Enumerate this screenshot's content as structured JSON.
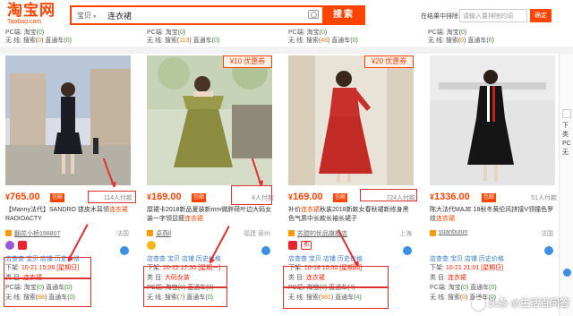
{
  "header": {
    "logo_cn": "淘宝网",
    "logo_en": "Taobao.com",
    "scope": "宝贝",
    "query": "连衣裙",
    "search_button": "搜索",
    "within_label": "在结果中排除",
    "within_placeholder": "请输入要排除的词",
    "within_button": "确定"
  },
  "previous_rows": [
    {
      "pc": "PC端: 淘宝(",
      "pc_n": "0",
      "pc_s": ")",
      "nl": "无 线: 搜索(",
      "n1": "0",
      "mid": ") 直通车(",
      "n2": "0",
      "end": ")"
    },
    {
      "pc": "PC端: 淘宝(",
      "pc_n": "0",
      "pc_s": ")",
      "nl": "无 线: 搜索(",
      "n1": "113",
      "mid": ") 直通车(",
      "n2": "0",
      "end": ")"
    },
    {
      "pc": "PC端: 淘宝(",
      "pc_n": "0",
      "pc_s": ")",
      "nl": "无 线: 搜索(",
      "n1": "48",
      "mid": ") 直通车(",
      "n2": "0",
      "end": ")"
    },
    {
      "pc": "PC端: 淘宝(",
      "pc_n": "0",
      "pc_s": ")",
      "nl": "无 线: 搜索(",
      "n1": "0",
      "mid": ") 直通车(",
      "n2": "0",
      "end": ")"
    }
  ],
  "cards": [
    {
      "promo": "",
      "price_yen": "¥",
      "price": "765.00",
      "baoyou": "包邮",
      "paid": "114人付款",
      "title_pre": "【Manny法代】SANDRO 镂皮木耳领",
      "title_kw": "连衣裙",
      "title_post": "RADIOACTY",
      "shop": "翻花小桥198807",
      "location": "法国",
      "badges": [
        "purple",
        "red"
      ],
      "tools": "店查查  宝贝  店铺  历史价格",
      "down": "下架: ",
      "down_time": "10-21 15:06 [星期日]",
      "cat_label": "类 目: ",
      "cat": "连衣裙",
      "pc": "PC端: 淘宝(",
      "pc_n1": "0",
      "pc_mid": ") 直通车(",
      "pc_n2": "0",
      "pc_end": ")",
      "wl": "无 线: 搜索(",
      "wl_n1": "88",
      "wl_mid": ") 直通车(",
      "wl_n2": "0",
      "wl_end": ")"
    },
    {
      "promo": "¥10 优惠券",
      "price_yen": "¥",
      "price": "169.00",
      "baoyou": "包邮",
      "paid": "4人付款",
      "title_pre": "糜裙卡2018新品夏装新mm微胖荷叶边大码女装一字领显瘦",
      "title_kw": "连衣裙",
      "title_post": "",
      "shop": "卓燕ll",
      "location": "福建 泉州",
      "badges": [
        "gold"
      ],
      "tools": "店查查  宝贝  店铺  历史价格",
      "down": "下架: ",
      "down_time": "10-22 17:50 [星期一]",
      "cat_label": "类 目: ",
      "cat": "大码女装",
      "pc": "PC端: 淘宝(",
      "pc_n1": "0",
      "pc_mid": ") 直通车(",
      "pc_n2": "0",
      "pc_end": ")",
      "wl": "无 线: 搜索(",
      "wl_n1": "7",
      "wl_mid": ") 直通车(",
      "wl_n2": "0",
      "wl_end": ")"
    },
    {
      "promo": "¥20 优惠券",
      "price_yen": "¥",
      "price": "169.00",
      "baoyou": "包邮",
      "paid": "724人付款",
      "title_pre": "补价",
      "title_kw": "连衣裙",
      "title_post": "秋装2018新款女春秋裙新修身黑色气质中长款长袖长裙子",
      "shop": "苏甜的优品旗舰店",
      "location": "上海",
      "badges": [
        "red",
        "xin"
      ],
      "tools": "店查查  宝贝  店铺  历史价格",
      "down": "下架: ",
      "down_time": "10-18 10:00 [星期四]",
      "cat_label": "类 目: ",
      "cat": "连衣裙",
      "pc": "PC端: 淘宝(",
      "pc_n1": "0",
      "pc_mid": ") 直通车(",
      "pc_n2": "4",
      "pc_end": ")",
      "wl": "无 线: 搜索(",
      "wl_n1": "981",
      "wl_mid": ") 直通车(",
      "wl_n2": "4",
      "wl_end": ")"
    },
    {
      "promo": "",
      "price_yen": "¥",
      "price": "1336.00",
      "baoyou": "包邮",
      "paid": "51人付款",
      "title_pre": "陈大法代MAJE 18秋冬黄伦风拼接V领撞色罗纹",
      "title_kw": "连衣裙",
      "title_post": "",
      "shop": "yuanbuiun",
      "location": "法国",
      "badges": [],
      "tools": "店查查  宝贝  店铺  历史价格",
      "down": "下架: ",
      "down_time": "10-21 21:01 [星期日]",
      "cat_label": "类 目: ",
      "cat": "连衣裙",
      "pc": "PC端: 淘宝(",
      "pc_n1": "0",
      "pc_mid": ") 直通车(",
      "pc_n2": "0",
      "pc_end": ")",
      "wl": "无 线: 搜索(",
      "wl_n1": "0",
      "wl_mid": ") 直通车(",
      "wl_n2": "0",
      "wl_end": ")"
    }
  ],
  "side": {
    "line1": "下",
    "line2": "类",
    "line3": "PC",
    "line4": "无"
  },
  "watermark": "头条 @生活百问答",
  "colors": {
    "brand": "#ff4400",
    "annotation": "#e03030",
    "link": "#3d7ec9",
    "green": "#2eae2e"
  }
}
